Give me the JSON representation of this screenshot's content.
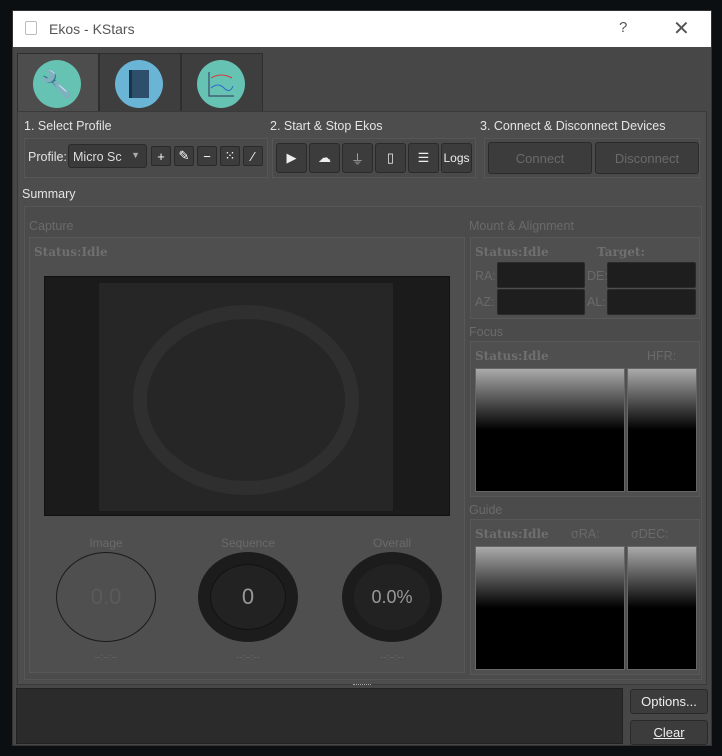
{
  "window": {
    "title": "Ekos - KStars",
    "help": "?",
    "close": "✕"
  },
  "tabs": [
    {
      "name": "setup",
      "icon": "wrench-screwdriver-icon"
    },
    {
      "name": "notebook",
      "icon": "book-icon"
    },
    {
      "name": "analyze",
      "icon": "graph-icon"
    }
  ],
  "sections": {
    "select_profile": "1. Select Profile",
    "start_stop": "2. Start & Stop Ekos",
    "connect": "3. Connect & Disconnect Devices",
    "summary": "Summary"
  },
  "profile": {
    "label": "Profile:",
    "value": "Micro Sc"
  },
  "profile_buttons": [
    "+",
    "✎",
    "−",
    "⁙",
    "⁄"
  ],
  "ekos_buttons": {
    "logs": "Logs"
  },
  "device_buttons": {
    "connect": "Connect",
    "disconnect": "Disconnect"
  },
  "capture": {
    "title": "Capture",
    "status": "Status:Idle",
    "image_label": "Image",
    "image_value": "0.0",
    "sequence_label": "Sequence",
    "sequence_value": "0",
    "overall_label": "Overall",
    "overall_value": "0.0%",
    "time": "--:--:--"
  },
  "mount": {
    "title": "Mount & Alignment",
    "status": "Status:Idle",
    "target": "Target:",
    "ra": "RA:",
    "de": "DE:",
    "az": "AZ:",
    "al": "AL:"
  },
  "focus": {
    "title": "Focus",
    "status": "Status:Idle",
    "hfr": "HFR:"
  },
  "guide": {
    "title": "Guide",
    "status": "Status:Idle",
    "ra": "σRA:",
    "dec": "σDEC:"
  },
  "log": {
    "options": "Options...",
    "clear": "Clear"
  }
}
